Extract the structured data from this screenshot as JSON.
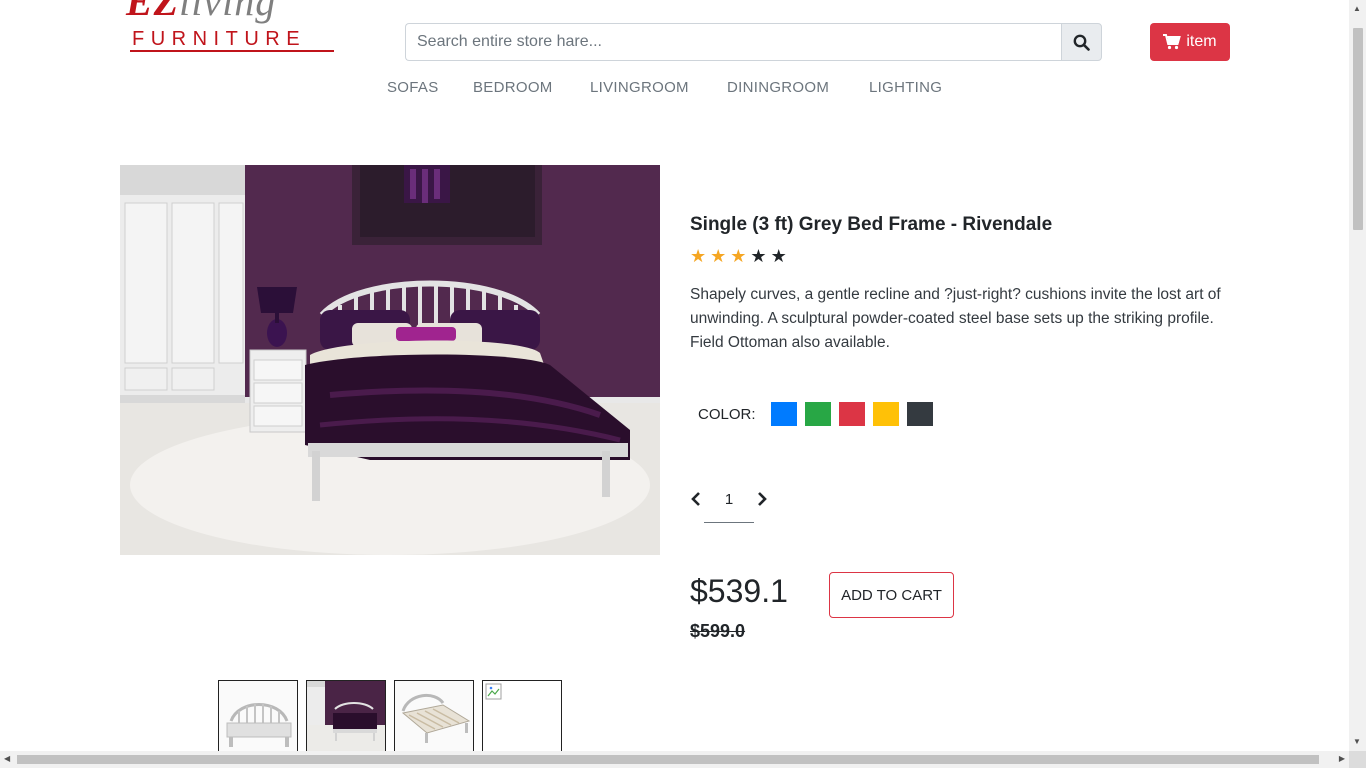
{
  "brand": {
    "name_script": "EZ",
    "name_script_tail": "living",
    "name_word": "FURNITURE",
    "color": "#c0141b"
  },
  "search": {
    "placeholder": "Search entire store hare...",
    "value": "",
    "icon": "search-icon"
  },
  "cart": {
    "label": "item",
    "icon": "shopping-cart-icon",
    "color": "#dc3545"
  },
  "nav": {
    "items": [
      "SOFAS",
      "BEDROOM",
      "LIVINGROOM",
      "DININGROOM",
      "LIGHTING"
    ]
  },
  "product": {
    "title": "Single (3 ft) Grey Bed Frame - Rivendale",
    "rating": {
      "value": 3,
      "max": 5,
      "filled_color": "#f5a623",
      "empty_color": "#212529"
    },
    "description": "Shapely curves, a gentle recline and ?just-right? cushions invite the lost art of unwinding. A sculptural powder-coated steel base sets up the striking profile. Field Ottoman also available.",
    "color_label": "COLOR:",
    "colors": [
      "#007bff",
      "#28a745",
      "#dc3545",
      "#ffc107",
      "#343a40"
    ],
    "quantity": "1",
    "price": "$539.1",
    "old_price": "$599.0",
    "add_to_cart_label": "ADD TO CART",
    "thumbnails": [
      "grey-bed-front-view",
      "purple-bedroom-scene",
      "bed-frame-open-slats",
      "broken-image"
    ]
  }
}
